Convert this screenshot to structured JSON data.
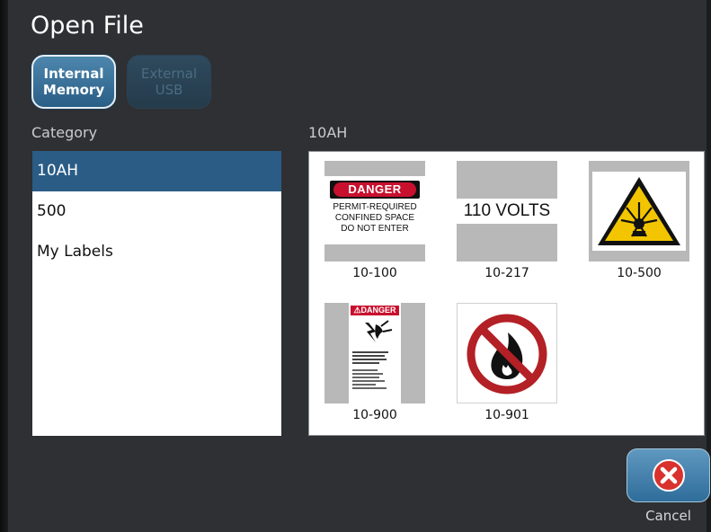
{
  "dialog": {
    "title": "Open File"
  },
  "memory": {
    "internal": {
      "line1": "Internal",
      "line2": "Memory",
      "state": "selected"
    },
    "external": {
      "line1": "External",
      "line2": "USB",
      "state": "disabled"
    }
  },
  "category": {
    "header": "Category",
    "items": [
      {
        "label": "10AH",
        "selected": true
      },
      {
        "label": "500",
        "selected": false
      },
      {
        "label": "My Labels",
        "selected": false
      }
    ]
  },
  "files": {
    "header": "10AH",
    "items": [
      {
        "name": "10-100",
        "sign": {
          "header": "DANGER",
          "lines": [
            "PERMIT-REQUIRED",
            "CONFINED SPACE",
            "DO NOT ENTER"
          ]
        }
      },
      {
        "name": "10-217",
        "sign": {
          "text": "110 VOLTS"
        }
      },
      {
        "name": "10-500",
        "icon": "explosive-hazard-icon"
      },
      {
        "name": "10-900",
        "sign": {
          "header": "DANGER"
        }
      },
      {
        "name": "10-901",
        "icon": "no-open-flame-icon"
      }
    ]
  },
  "actions": {
    "cancel_label": "Cancel",
    "cancel_icon": "close-icon"
  },
  "colors": {
    "accent": "#2a5c86",
    "background": "#2e3033",
    "danger_red": "#c8102e",
    "cancel_red": "#d9322e",
    "warning_yellow": "#f2c500"
  }
}
